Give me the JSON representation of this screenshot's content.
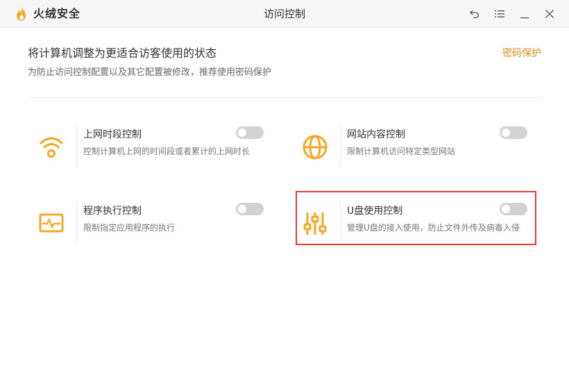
{
  "app": {
    "name": "火绒安全",
    "window_title": "访问控制"
  },
  "window_controls": {
    "back_icon": "undo-arrow",
    "menu_icon": "hamburger-menu",
    "minimize_icon": "minus",
    "close_icon": "x"
  },
  "header": {
    "headline": "将计算机调整为更适合访客使用的状态",
    "subline": "为防止访问控制配置以及其它配置被修改，推荐使用密码保护",
    "password_link": "密码保护"
  },
  "controls": [
    {
      "title": "上网时段控制",
      "desc": "控制计算机上网的时间段或者累计的上网时长",
      "icon": "wifi-icon",
      "enabled": false
    },
    {
      "title": "网站内容控制",
      "desc": "限制计算机访问特定类型网站",
      "icon": "globe-icon",
      "enabled": false
    },
    {
      "title": "程序执行控制",
      "desc": "限制指定应用程序的执行",
      "icon": "monitor-pulse-icon",
      "enabled": false
    },
    {
      "title": "U盘使用控制",
      "desc": "管理U盘的接入使用，防止文件外传及病毒入侵",
      "icon": "sliders-icon",
      "enabled": false
    }
  ],
  "colors": {
    "accent": "#f5a623",
    "link": "#e08a1e",
    "toggle_off": "#d2d2d2",
    "highlight": "#e53935"
  }
}
